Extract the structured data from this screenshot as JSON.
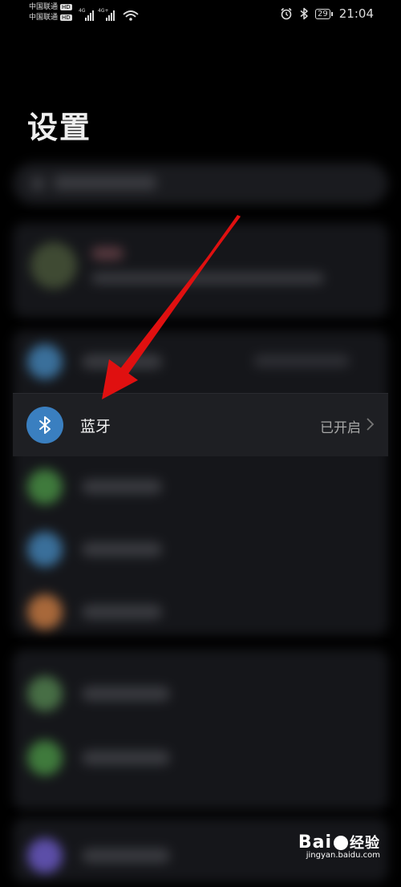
{
  "status_bar": {
    "carrier1": "中国联通",
    "carrier2": "中国联通",
    "hd_badge": "HD",
    "network1": "4G",
    "network2": "4G+",
    "battery": "29",
    "time": "21:04"
  },
  "page": {
    "title": "设置"
  },
  "bluetooth": {
    "label": "蓝牙",
    "status": "已开启",
    "icon": "bluetooth-icon",
    "accent": "#3a7fc0"
  },
  "list_icon_colors": [
    "#3a6f9a",
    "#3f7a3c",
    "#3a6f9a",
    "#a8683a",
    "#476e45",
    "#3f7a3c",
    "#5c4ea8"
  ],
  "watermark": {
    "logo": "Bai",
    "logo_cn": "经验",
    "url": "jingyan.baidu.com"
  },
  "annotation": {
    "arrow_color": "#e01010"
  }
}
